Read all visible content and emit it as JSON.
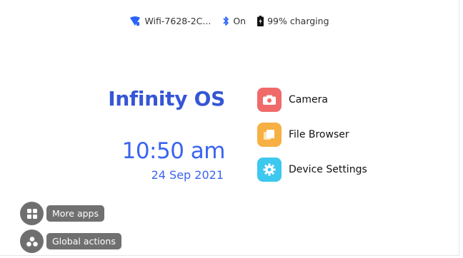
{
  "status": {
    "wifi_label": "Wifi-7628-2C...",
    "bluetooth_label": "On",
    "battery_label": "99% charging"
  },
  "brand": {
    "title": "Infinity OS"
  },
  "clock": {
    "time": "10:50 am",
    "date": "24 Sep 2021"
  },
  "apps": [
    {
      "label": "Camera",
      "icon": "camera-icon",
      "color": "#f06a6a"
    },
    {
      "label": "File Browser",
      "icon": "folder-icon",
      "color": "#f7b043"
    },
    {
      "label": "Device Settings",
      "icon": "gear-icon",
      "color": "#3cc8ef"
    }
  ],
  "actions": {
    "more_apps": "More apps",
    "global_actions": "Global actions"
  },
  "colors": {
    "accent": "#3a64f0",
    "status_icons": "#2a63f5",
    "chip": "#707070"
  }
}
